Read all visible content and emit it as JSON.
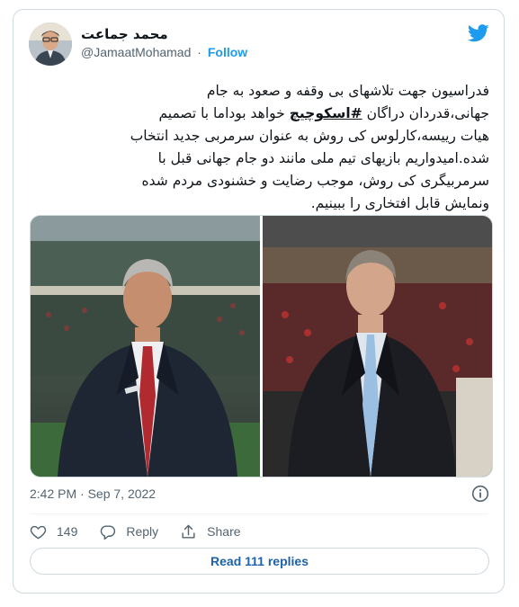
{
  "tweet": {
    "author_name": "محمد جماعت",
    "handle": "@JamaatMohamad",
    "separator": "·",
    "follow_label": "Follow",
    "text_lines": [
      "فدراسیون جهت تلاشهای بی وقفه و صعود به جام",
      "خواهد بوداما با تصمیم",
      "جهانی،قدردان دراگان",
      "هیات ریيسه،کارلوس کی روش به عنوان سرمربی جدید انتخاب",
      "شده.امیدواریم بازیهای تیم ملی مانند دو جام جهانی قبل با",
      "سرمربیگری کی روش، موجب رضایت و خشنودی مردم شده",
      "ونمایش قابل افتخاری را ببینیم."
    ],
    "hashtag": "#اسکوچیچ",
    "timestamp": "2:42 PM · Sep 7, 2022",
    "like_count": "149",
    "reply_label": "Reply",
    "share_label": "Share",
    "read_replies_label": "Read 111 replies"
  },
  "media": {
    "left_photo": "carlos-queiroz-photo",
    "right_photo": "dragan-skocic-photo"
  },
  "colors": {
    "brand_blue": "#1d9bf0",
    "text": "#0f1419",
    "secondary": "#536471",
    "border": "#cfd9de",
    "read_replies": "#1d62ab"
  },
  "icons": [
    "twitter-bird-icon",
    "info-icon",
    "heart-icon",
    "reply-icon",
    "share-icon"
  ]
}
